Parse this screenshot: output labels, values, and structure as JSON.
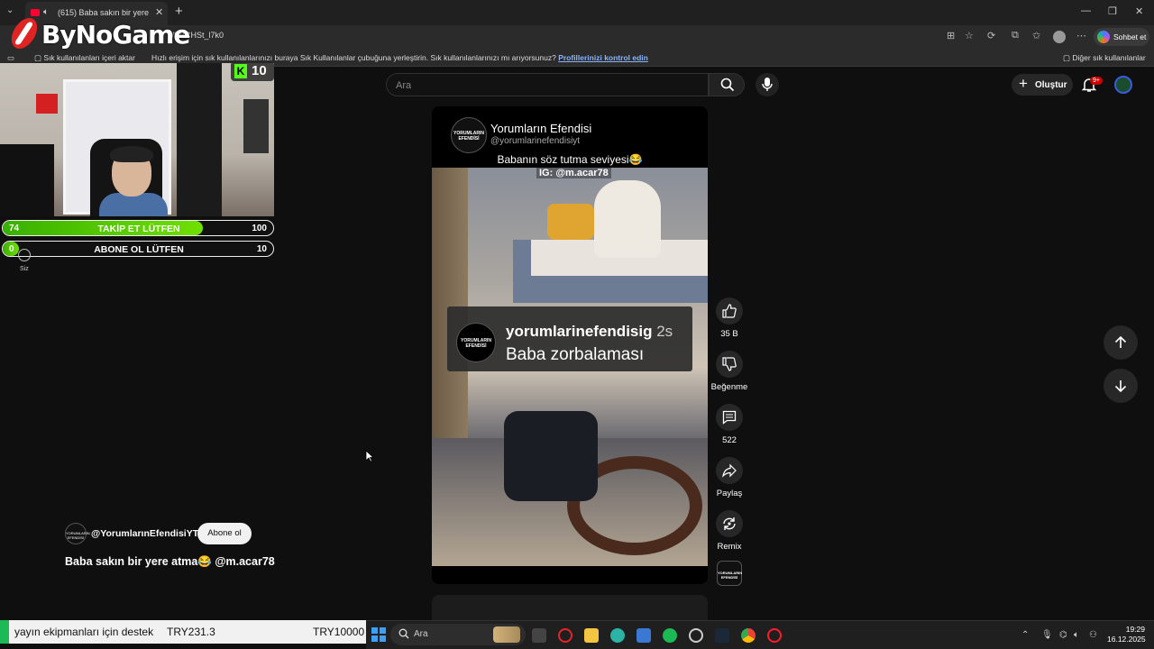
{
  "browser": {
    "tab_title": "(615) Baba sakın bir yere atma",
    "url": "s/KBCHSt_l7k0",
    "copilot_label": "Sohbet et",
    "bookmarks": {
      "import_label": "Sık kullanılanları içeri aktar",
      "hint": "Hızlı erişim için sık kullanılanlarınızı buraya Sık Kullanılanlar çubuğuna yerleştirin. Sık kullanılanlarınızı mı arıyorsunuz?",
      "hint_link": "Profillerinizi kontrol edin",
      "other": "Diğer sık kullanılanlar"
    }
  },
  "overlay": {
    "logo_text": "ByNoGame",
    "kick_viewers": "10",
    "goal_follow": {
      "label": "TAKİP ET LÜTFEN",
      "current": "74",
      "target": "100",
      "progress": 0.74
    },
    "goal_sub": {
      "label": "ABONE OL LÜTFEN",
      "current": "0",
      "target": "10",
      "progress": 0.0
    },
    "siz_label": "Siz"
  },
  "youtube": {
    "search_placeholder": "Ara",
    "create_label": "Oluştur",
    "notif_badge": "9+",
    "short": {
      "channel_name": "Yorumların Efendisi",
      "channel_handle": "@yorumlarinefendisiyt",
      "caption": "Babanın söz tutma seviyesi😂",
      "watermark": "IG: @m.acar78",
      "avatar_text": "YORUMLARIN EFENDİSİ",
      "comment_user": "yorumlarinefendisig",
      "comment_time": "2s",
      "comment_text": "Baba zorbalaması"
    },
    "actions": {
      "like_count": "35 B",
      "dislike_label": "Beğenme",
      "comments_count": "522",
      "share_label": "Paylaş",
      "remix_label": "Remix"
    },
    "channel": {
      "handle": "@YorumlarınEfendisiYT",
      "subscribe_label": "Abone ol",
      "video_title": "Baba sakın bir yere atma😂 @m.acar78"
    }
  },
  "ticker": {
    "text": "yayın ekipmanları için destek",
    "amount": "TRY231.3",
    "goal": "TRY10000"
  },
  "taskbar": {
    "search_label": "Ara",
    "time": "19:29",
    "date": "16.12.2025"
  }
}
